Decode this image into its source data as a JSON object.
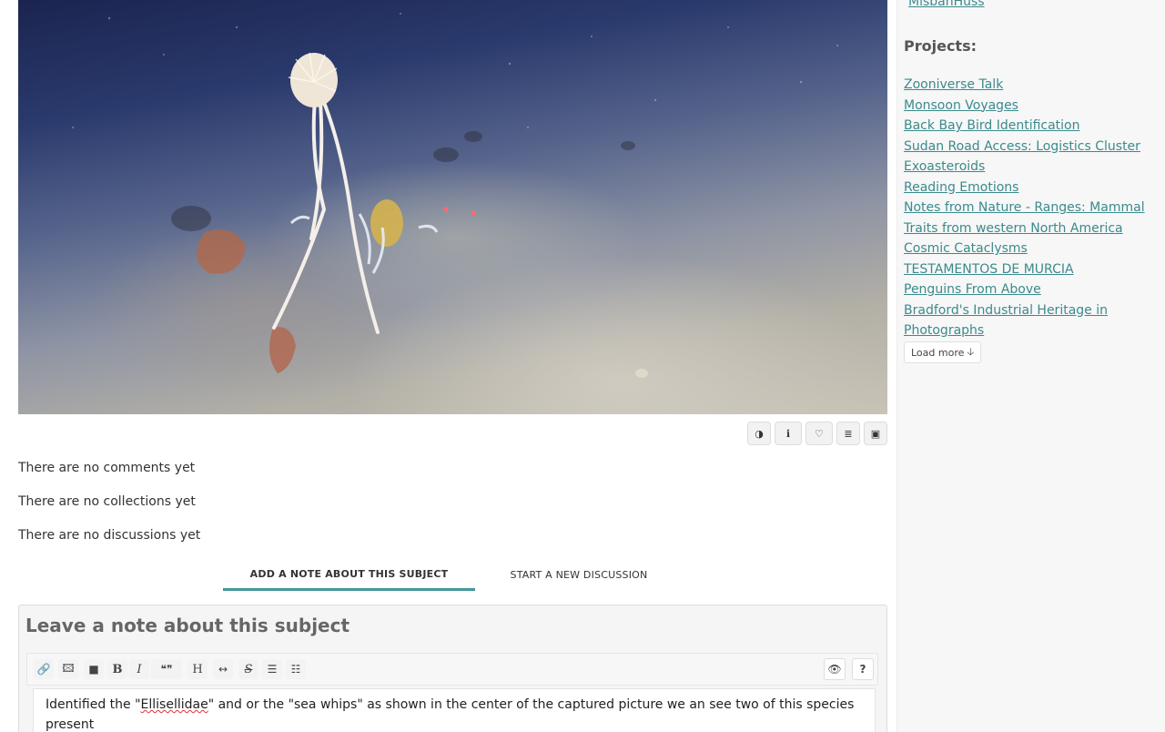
{
  "subject": {
    "toolbar": [
      {
        "name": "invert-icon",
        "glyph": "◑"
      },
      {
        "name": "info-icon",
        "glyph": "ℹ"
      },
      {
        "name": "heart-icon",
        "glyph": "♡"
      },
      {
        "name": "list-icon",
        "glyph": "≣"
      },
      {
        "name": "image-icon",
        "glyph": "▣"
      }
    ]
  },
  "status": {
    "comments": "There are no comments yet",
    "collections": "There are no collections yet",
    "discussions": "There are no discussions yet"
  },
  "tabs": {
    "add_note": "ADD A NOTE ABOUT THIS SUBJECT",
    "new_discussion": "START A NEW DISCUSSION"
  },
  "note": {
    "title": "Leave a note about this subject",
    "toolbar": {
      "link": "🔗",
      "image": "🖾",
      "video": "■",
      "bold": "B",
      "italic": "I",
      "quote": "❝❞",
      "heading": "H",
      "hr": "↔",
      "strike": "S",
      "bullets": "☰",
      "numbered": "☷",
      "preview": "👁",
      "help": "?"
    },
    "text_before": "Identified the \"",
    "text_misspelled": "Ellisellidae",
    "text_after": "\" and or the \"sea whips\" as shown in the center of the captured picture we an see two of this species present"
  },
  "sidebar": {
    "user": "MisbahHuss",
    "projects_heading": "Projects:",
    "projects": [
      "Zooniverse Talk",
      "Monsoon Voyages",
      "Back Bay Bird Identification",
      "Sudan Road Access: Logistics Cluster",
      "Exoasteroids",
      "Reading Emotions",
      "Notes from Nature - Ranges: Mammal ",
      "Traits from western North America",
      "Cosmic Cataclysms ",
      "TESTAMENTOS DE MURCIA",
      "Penguins From Above",
      "Bradford's Industrial Heritage in ",
      "Photographs"
    ],
    "load_more": "Load more",
    "load_more_icon": "🡣"
  },
  "colors": {
    "accent": "#43979a",
    "link": "#3b8a8c"
  }
}
